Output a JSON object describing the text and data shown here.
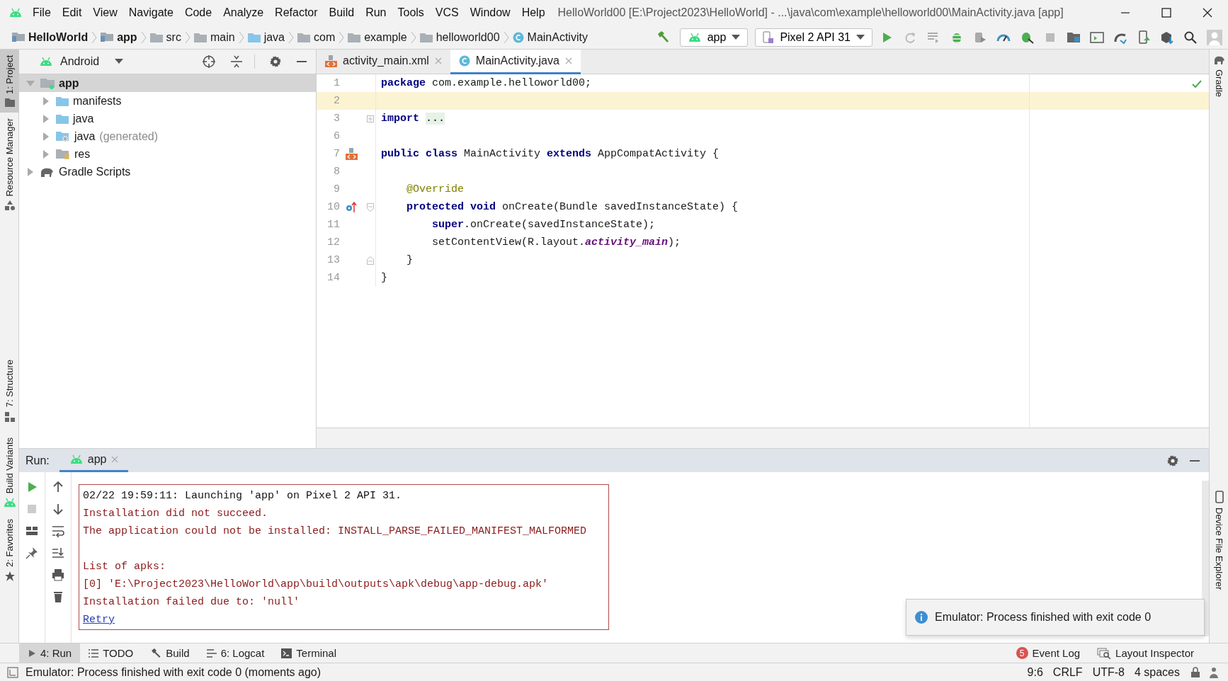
{
  "window": {
    "title": "HelloWorld00 [E:\\Project2023\\HelloWorld] - ...\\java\\com\\example\\helloworld00\\MainActivity.java [app]"
  },
  "menu": [
    "File",
    "Edit",
    "View",
    "Navigate",
    "Code",
    "Analyze",
    "Refactor",
    "Build",
    "Run",
    "Tools",
    "VCS",
    "Window",
    "Help"
  ],
  "breadcrumbs": [
    {
      "label": "HelloWorld",
      "kind": "project"
    },
    {
      "label": "app",
      "kind": "module"
    },
    {
      "label": "src",
      "kind": "folder"
    },
    {
      "label": "main",
      "kind": "folder"
    },
    {
      "label": "java",
      "kind": "source_folder"
    },
    {
      "label": "com",
      "kind": "package"
    },
    {
      "label": "example",
      "kind": "package"
    },
    {
      "label": "helloworld00",
      "kind": "package"
    },
    {
      "label": "MainActivity",
      "kind": "class"
    }
  ],
  "toolbar": {
    "run_configuration": "app",
    "device": "Pixel 2 API 31"
  },
  "left_strip": [
    {
      "label": "1: Project",
      "selected": true,
      "kind": "project"
    },
    {
      "label": "Resource Manager",
      "selected": false,
      "kind": "resources"
    },
    {
      "label": "7: Structure",
      "selected": false,
      "kind": "structure"
    },
    {
      "label": "Build Variants",
      "selected": false,
      "kind": "variants"
    },
    {
      "label": "2: Favorites",
      "selected": false,
      "kind": "favorites"
    }
  ],
  "right_strip": [
    {
      "label": "Gradle",
      "kind": "gradle"
    },
    {
      "label": "Device File Explorer",
      "kind": "device"
    }
  ],
  "project_panel": {
    "view": "Android",
    "tree": [
      {
        "label": "app",
        "kind": "module",
        "selected": true,
        "expanded": true,
        "children": [
          {
            "label": "manifests",
            "kind": "folder",
            "selected": false,
            "expanded": false
          },
          {
            "label": "java",
            "kind": "folder",
            "selected": false,
            "expanded": false
          },
          {
            "label": "java",
            "hint": "(generated)",
            "kind": "generated_folder",
            "selected": false,
            "expanded": false
          },
          {
            "label": "res",
            "kind": "res_folder",
            "selected": false,
            "expanded": false
          }
        ]
      },
      {
        "label": "Gradle Scripts",
        "kind": "gradle",
        "selected": false,
        "expanded": false
      }
    ]
  },
  "editor": {
    "tabs": [
      {
        "label": "activity_main.xml",
        "kind": "xml",
        "selected": false
      },
      {
        "label": "MainActivity.java",
        "kind": "class",
        "selected": true
      }
    ],
    "lines": [
      {
        "number": "1",
        "current": false,
        "tokens": [
          {
            "text": "package",
            "kind": "keyword"
          },
          {
            "text": " com.example.helloworld00;",
            "kind": "plain"
          }
        ]
      },
      {
        "number": "2",
        "current": true
      },
      {
        "number": "3",
        "current": false,
        "fold": {
          "kind": "collapsed"
        },
        "tokens": [
          {
            "text": "import",
            "kind": "keyword"
          },
          {
            "text": "...",
            "kind": "folded"
          }
        ]
      },
      {
        "number": "6",
        "current": false
      },
      {
        "number": "7",
        "current": false,
        "gutter": {
          "kind": "layout"
        },
        "tokens": [
          {
            "text": "public class",
            "kind": "keyword"
          },
          {
            "text": " MainActivity ",
            "kind": "plain"
          },
          {
            "text": "extends",
            "kind": "keyword"
          },
          {
            "text": " AppCompatActivity {",
            "kind": "plain"
          }
        ]
      },
      {
        "number": "8",
        "current": false
      },
      {
        "number": "9",
        "current": false,
        "tokens": [
          {
            "text": "    @Override",
            "kind": "annotation"
          }
        ]
      },
      {
        "number": "10",
        "current": false,
        "gutter": {
          "kind": "override"
        },
        "fold": {
          "kind": "open"
        },
        "tokens": [
          {
            "text": "    protected void",
            "kind": "keyword"
          },
          {
            "text": " onCreate(Bundle savedInstanceState) {",
            "kind": "plain"
          }
        ]
      },
      {
        "number": "11",
        "current": false,
        "tokens": [
          {
            "text": "        super",
            "kind": "keyword"
          },
          {
            "text": ".onCreate(savedInstanceState);",
            "kind": "plain"
          }
        ]
      },
      {
        "number": "12",
        "current": false,
        "tokens": [
          {
            "text": "        setContentView(R.layout.",
            "kind": "plain"
          },
          {
            "text": "activity_main",
            "kind": "static_field"
          },
          {
            "text": ");",
            "kind": "plain"
          }
        ]
      },
      {
        "number": "13",
        "current": false,
        "fold": {
          "kind": "end"
        },
        "tokens": [
          {
            "text": "    }",
            "kind": "plain"
          }
        ]
      },
      {
        "number": "14",
        "current": false,
        "tokens": [
          {
            "text": "}",
            "kind": "plain"
          }
        ]
      }
    ]
  },
  "run_panel": {
    "title": "Run:",
    "tabs": [
      {
        "label": "app",
        "selected": true
      }
    ],
    "console_blocks": [
      {
        "lines": [
          {
            "text": "02/22 19:59:11: Launching 'app' on Pixel 2 API 31.",
            "kind": "info"
          },
          {
            "text": "Installation did not succeed.",
            "kind": "error"
          },
          {
            "text": "The application could not be installed: INSTALL_PARSE_FAILED_MANIFEST_MALFORMED",
            "kind": "error"
          }
        ]
      },
      {
        "lines": [
          {
            "text": "List of apks:",
            "kind": "error"
          },
          {
            "text": "[0] 'E:\\Project2023\\HelloWorld\\app\\build\\outputs\\apk\\debug\\app-debug.apk'",
            "kind": "error"
          },
          {
            "text": "Installation failed due to: 'null'",
            "kind": "error"
          },
          {
            "text": "Retry",
            "kind": "link"
          }
        ]
      }
    ]
  },
  "notification": {
    "text": "Emulator: Process finished with exit code 0",
    "kind": "info"
  },
  "bottom_tabs": [
    {
      "label": "4: Run",
      "kind": "run",
      "selected": true
    },
    {
      "label": "TODO",
      "kind": "todo",
      "selected": false
    },
    {
      "label": "Build",
      "kind": "build",
      "selected": false
    },
    {
      "label": "6: Logcat",
      "kind": "logcat",
      "selected": false
    },
    {
      "label": "Terminal",
      "kind": "terminal",
      "selected": false
    }
  ],
  "bottom_right_tabs": [
    {
      "label": "Event Log",
      "kind": "event_log",
      "badge": "5"
    },
    {
      "label": "Layout Inspector",
      "kind": "inspector"
    }
  ],
  "status_bar": {
    "message": "Emulator: Process finished with exit code 0 (moments ago)",
    "items": [
      "9:6",
      "CRLF",
      "UTF-8",
      "4 spaces"
    ]
  }
}
